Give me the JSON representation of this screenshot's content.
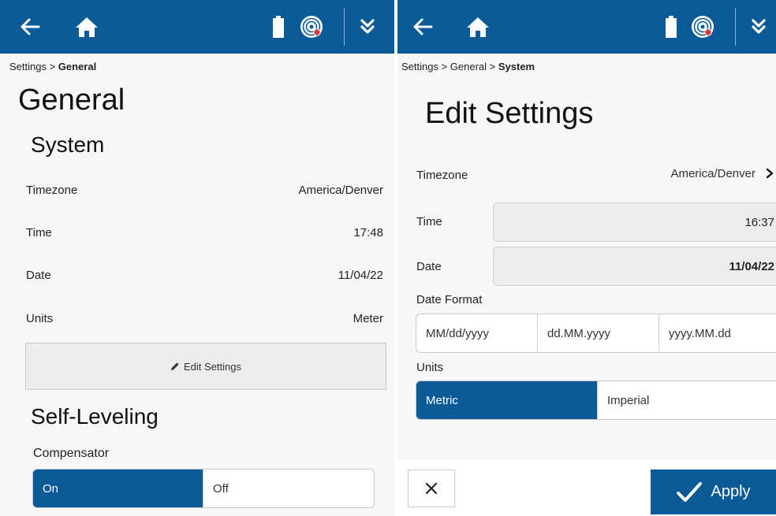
{
  "left_screen": {
    "breadcrumb": {
      "parent": "Settings > ",
      "current": "General"
    },
    "title": "General",
    "system_section": {
      "title": "System",
      "rows": [
        {
          "label": "Timezone",
          "value": "America/Denver"
        },
        {
          "label": "Time",
          "value": "17:48"
        },
        {
          "label": "Date",
          "value": "11/04/22"
        },
        {
          "label": "Units",
          "value": "Meter"
        }
      ],
      "edit_button_label": "Edit Settings"
    },
    "self_leveling_section": {
      "title": "Self-Leveling",
      "compensator_label": "Compensator",
      "compensator_options": [
        "On",
        "Off"
      ],
      "compensator_selected": "On"
    }
  },
  "right_screen": {
    "breadcrumb": {
      "parent": "Settings > General > ",
      "current": "System"
    },
    "title": "Edit Settings",
    "timezone": {
      "label": "Timezone",
      "value": "America/Denver"
    },
    "time": {
      "label": "Time",
      "value": "16:37"
    },
    "date": {
      "label": "Date",
      "value": "11/04/22"
    },
    "date_format": {
      "label": "Date Format",
      "options": [
        "MM/dd/yyyy",
        "dd.MM.yyyy",
        "yyyy.MM.dd"
      ]
    },
    "units": {
      "label": "Units",
      "options": [
        "Metric",
        "Imperial"
      ],
      "selected": "Metric"
    },
    "apply_label": "Apply"
  },
  "icons": [
    "back-arrow-icon",
    "home-icon",
    "battery-icon",
    "target-sensor-icon",
    "double-chevron-down-icon",
    "pencil-icon",
    "close-icon",
    "checkmark-icon",
    "chevron-right-icon"
  ],
  "colors": {
    "primary": "#0a5a98",
    "background": "#f7f7f7",
    "field": "#ececec",
    "alert_dot": "#d9363e"
  }
}
